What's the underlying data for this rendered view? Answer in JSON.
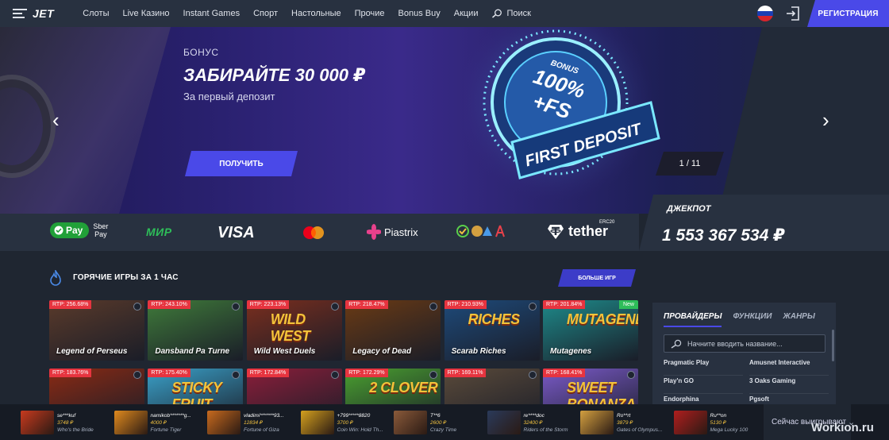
{
  "header": {
    "logo": "JET",
    "nav": [
      "Слоты",
      "Live Казино",
      "Instant Games",
      "Спорт",
      "Настольные",
      "Прочие",
      "Bonus Buy",
      "Акции",
      "Поиск"
    ],
    "register": "РЕГИСТРАЦИЯ",
    "flag_colors": [
      "#ffffff",
      "#1c3fb5",
      "#d6242c"
    ]
  },
  "hero": {
    "label": "БОНУС",
    "title": "ЗАБИРАЙТЕ 30 000 ₽",
    "subtitle": "За первый депозит",
    "button": "ПОЛУЧИТЬ",
    "counter": "1 / 11",
    "badge_top": "BONUS",
    "badge_main": "100%",
    "badge_fs": "+FS",
    "badge_ribbon": "FIRST DEPOSIT"
  },
  "payments": {
    "sberpay_pill": "Pay",
    "sberpay_text": [
      "Sber",
      "Pay"
    ],
    "mir": "МИР",
    "visa": "VISA",
    "piastrix": "Piastrix",
    "tether": "tether",
    "tether_tag": "ERC20"
  },
  "jackpot": {
    "label": "ДЖЕКПОТ",
    "value": "1 553 367 534 ₽"
  },
  "hot": {
    "title": "ГОРЯЧИЕ ИГРЫ ЗА 1 ЧАС",
    "more": "БОЛЬШЕ ИГР"
  },
  "games": [
    {
      "rtp": "RTP: 256.68%",
      "name": "Legend of Perseus",
      "art": "",
      "bg": "#5a3a2a"
    },
    {
      "rtp": "RTP: 243.10%",
      "name": "Dansband Pa Turne",
      "art": "",
      "bg": "#3f7a3a"
    },
    {
      "rtp": "RTP: 223.13%",
      "name": "Wild West Duels",
      "art": "WILD WEST",
      "bg": "#7a2e1e"
    },
    {
      "rtp": "RTP: 218.47%",
      "name": "Legacy of Dead",
      "art": "",
      "bg": "#6a3a14"
    },
    {
      "rtp": "RTP: 210.93%",
      "name": "Scarab Riches",
      "art": "RICHES",
      "bg": "#1e4a7a"
    },
    {
      "rtp": "RTP: 201.84%",
      "name": "Mutagenes",
      "art": "MUTAGENES",
      "bg": "#1e8a8a",
      "new": "New"
    },
    {
      "rtp": "RTP: 183.76%",
      "name": "",
      "art": "",
      "bg": "#8a2a14"
    },
    {
      "rtp": "RTP: 175.40%",
      "name": "",
      "art": "STICKY FRUIT",
      "bg": "#3aa0c8"
    },
    {
      "rtp": "RTP: 172.84%",
      "name": "",
      "art": "",
      "bg": "#8a1e3a"
    },
    {
      "rtp": "RTP: 172.29%",
      "name": "",
      "art": "2 CLOVER",
      "bg": "#4aa030"
    },
    {
      "rtp": "RTP: 169.11%",
      "name": "",
      "art": "",
      "bg": "#5a4a3a"
    },
    {
      "rtp": "RTP: 168.41%",
      "name": "",
      "art": "SWEET BONANZA",
      "bg": "#7a5ac8"
    }
  ],
  "providers": {
    "tabs": [
      "ПРОВАЙДЕРЫ",
      "ФУНКЦИИ",
      "ЖАНРЫ"
    ],
    "search_placeholder": "Начните вводить название...",
    "items": [
      "Pragmatic Play",
      "Amusnet Interactive",
      "Play'n GO",
      "3 Oaks Gaming",
      "Endorphina",
      "Pgsoft"
    ]
  },
  "ticker": {
    "wins": [
      {
        "user": "se***kuf",
        "amount": "3748 ₽",
        "game": "Who's the Bride",
        "color": "#c83a1e"
      },
      {
        "user": "namikob*******g...",
        "amount": "4000 ₽",
        "game": "Fortune Tiger",
        "color": "#e08a1e"
      },
      {
        "user": "vladimi*******93...",
        "amount": "12834 ₽",
        "game": "Fortune of Giza",
        "color": "#c86a1e"
      },
      {
        "user": "+799*****8820",
        "amount": "3700 ₽",
        "game": "Coin Win: Hold Th...",
        "color": "#d4a01e"
      },
      {
        "user": "T**6",
        "amount": "2600 ₽",
        "game": "Crazy Time",
        "color": "#8a5a3a"
      },
      {
        "user": "re****doc",
        "amount": "32400 ₽",
        "game": "Riders of the Storm",
        "color": "#2a3a5a"
      },
      {
        "user": "Ro**rt",
        "amount": "3879 ₽",
        "game": "Gates of Olympus...",
        "color": "#d4a040"
      },
      {
        "user": "Ru**on",
        "amount": "5130 ₽",
        "game": "Mega Lucky 100",
        "color": "#b01e1e"
      }
    ],
    "now_playing": "Сейчас выигрывают"
  },
  "watermark": "Workion.ru"
}
